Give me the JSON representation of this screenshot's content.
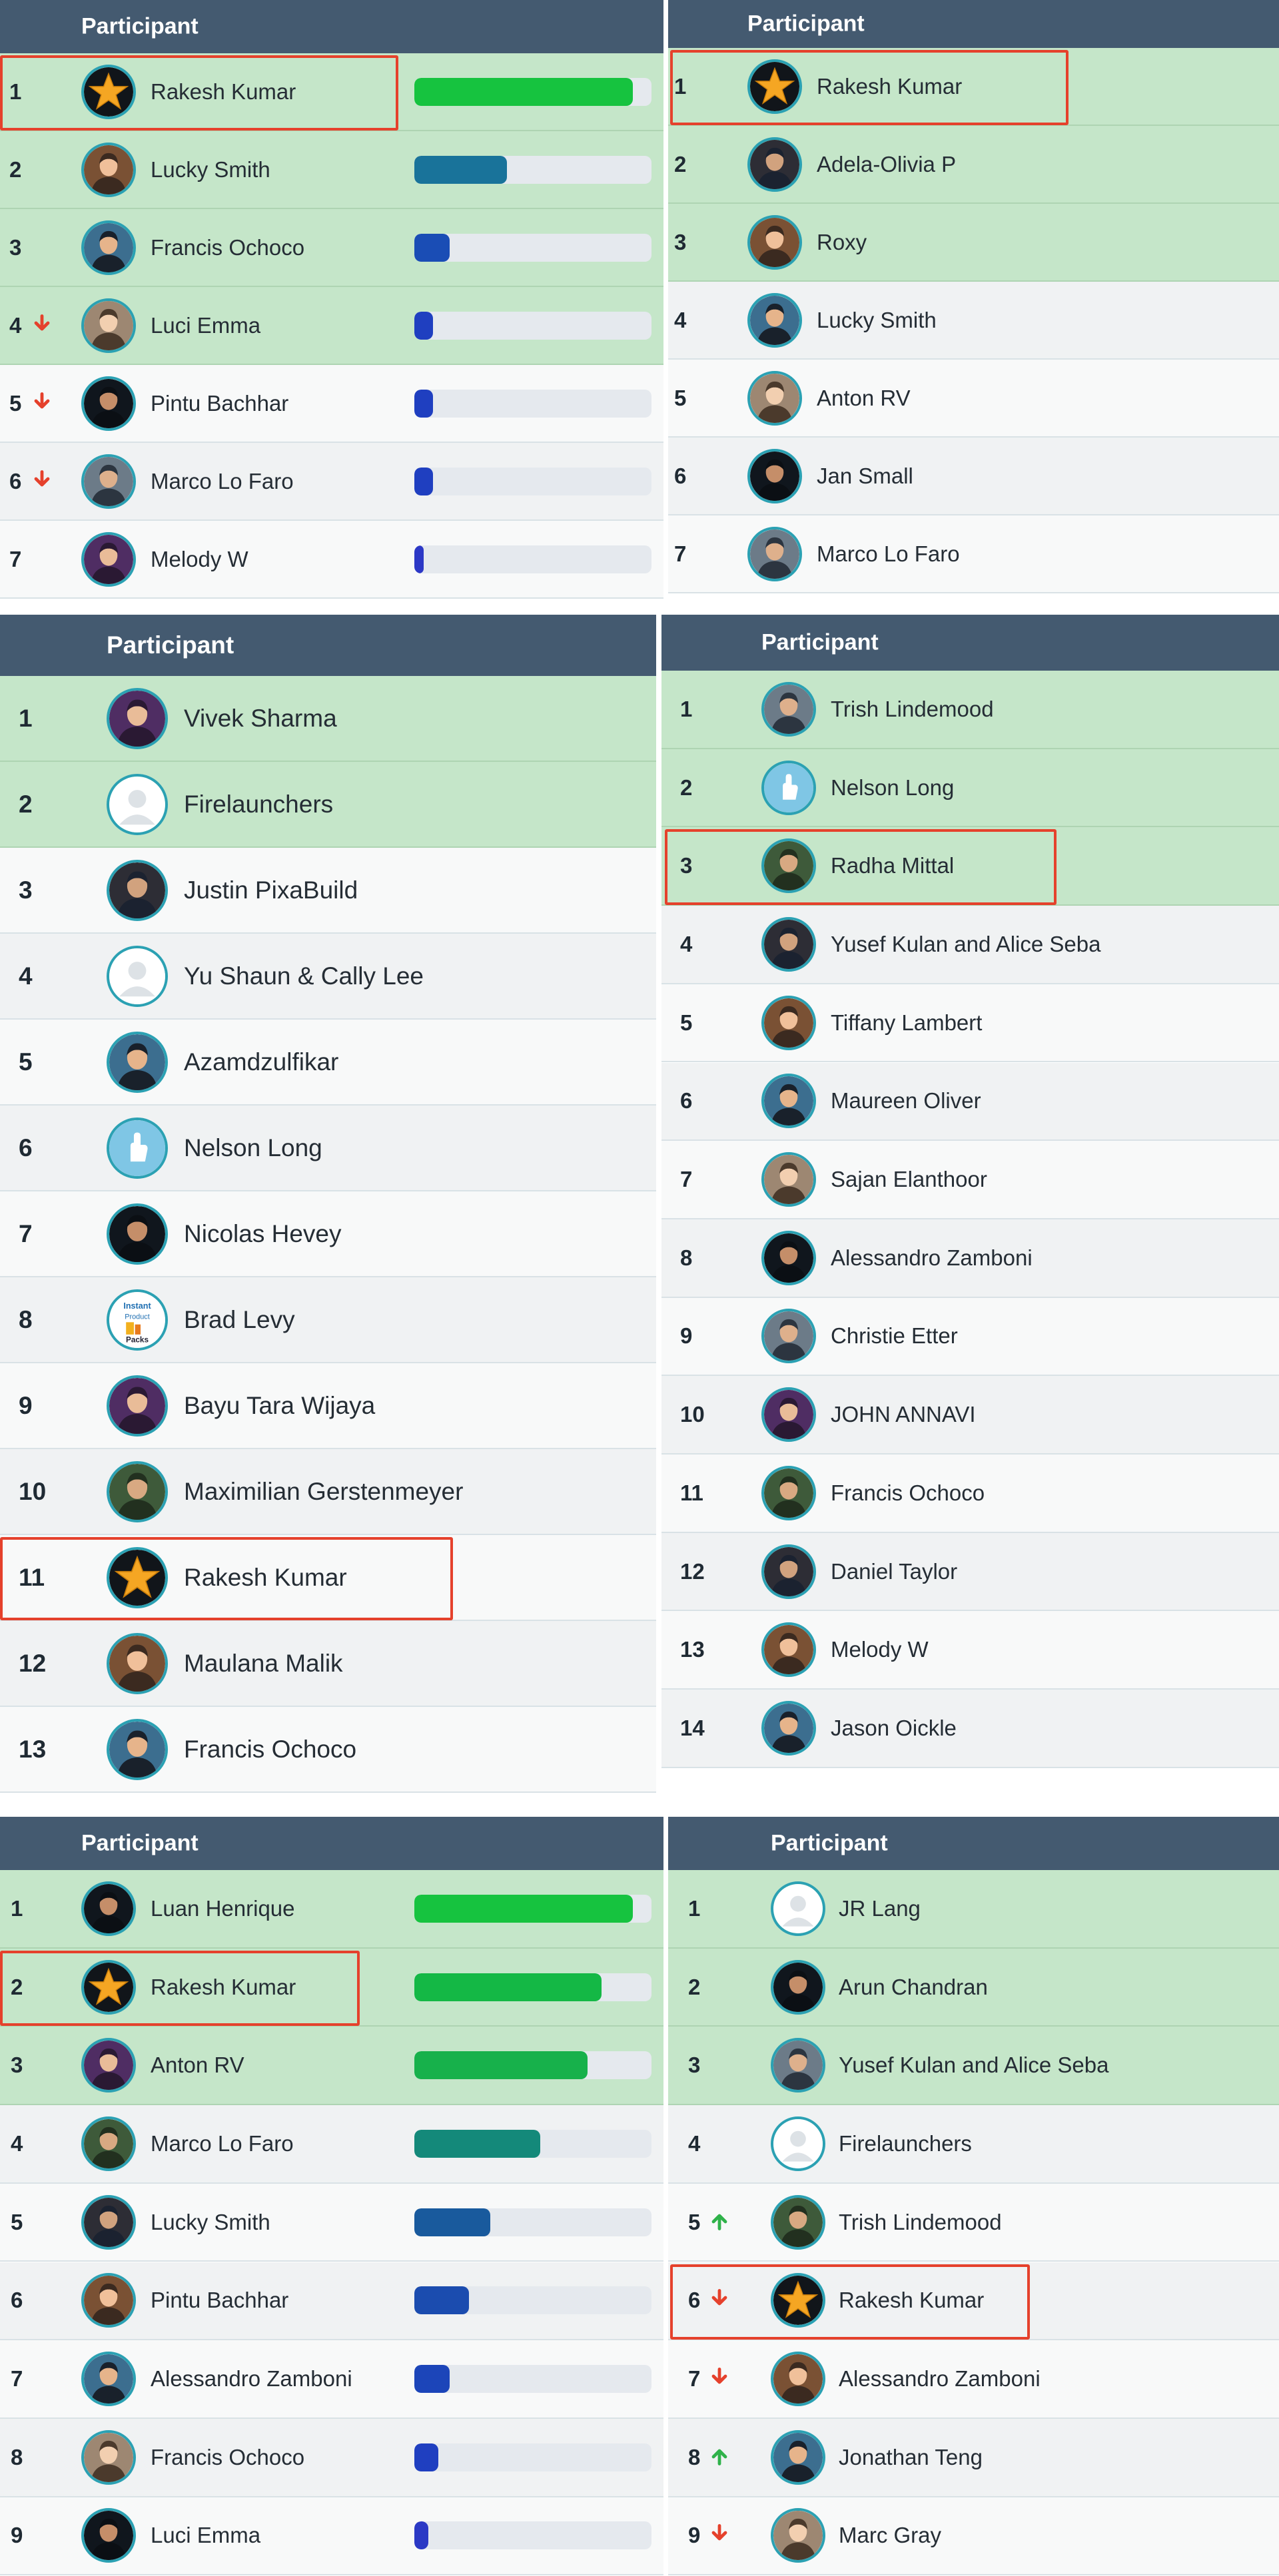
{
  "colors": {
    "header": "#445a70",
    "highlight_row": "#c5e6c9",
    "avatar_ring": "#2ba1b3",
    "callout_border": "#e5412c",
    "arrow_down": "#e5412c",
    "arrow_up": "#2fb24a",
    "bar_track": "#e5e9ee"
  },
  "panels": [
    {
      "id": "panel-1",
      "header": "Participant",
      "has_bars": true,
      "rows": [
        {
          "rank": "1",
          "name": "Rakesh Kumar",
          "avatar": "star-avatar",
          "highlight": true,
          "trend": "",
          "progress": 0.92,
          "bar_color": "#16c33f",
          "callout": true
        },
        {
          "rank": "2",
          "name": "Lucky Smith",
          "avatar": "person-avatar",
          "highlight": true,
          "trend": "",
          "progress": 0.39,
          "bar_color": "#19739a"
        },
        {
          "rank": "3",
          "name": "Francis Ochoco",
          "avatar": "person-avatar",
          "highlight": true,
          "trend": "",
          "progress": 0.15,
          "bar_color": "#1a4db5"
        },
        {
          "rank": "4",
          "name": "Luci Emma",
          "avatar": "person-avatar",
          "highlight": true,
          "trend": "down",
          "progress": 0.08,
          "bar_color": "#1f3fc0"
        },
        {
          "rank": "5",
          "name": "Pintu Bachhar",
          "avatar": "person-avatar",
          "highlight": false,
          "trend": "down",
          "progress": 0.08,
          "bar_color": "#1f3fc0"
        },
        {
          "rank": "6",
          "name": "Marco Lo Faro",
          "avatar": "person-avatar",
          "highlight": false,
          "trend": "down",
          "progress": 0.08,
          "bar_color": "#1f3fc0"
        },
        {
          "rank": "7",
          "name": "Melody W",
          "avatar": "person-avatar",
          "highlight": false,
          "trend": "",
          "progress": 0.04,
          "bar_color": "#2c38c6"
        }
      ]
    },
    {
      "id": "panel-2",
      "header": "Participant",
      "has_bars": false,
      "rows": [
        {
          "rank": "1",
          "name": "Rakesh Kumar",
          "avatar": "star-avatar",
          "highlight": true,
          "trend": "",
          "callout": true
        },
        {
          "rank": "2",
          "name": "Adela-Olivia P",
          "avatar": "person-avatar",
          "highlight": true,
          "trend": ""
        },
        {
          "rank": "3",
          "name": "Roxy",
          "avatar": "person-avatar",
          "highlight": true,
          "trend": ""
        },
        {
          "rank": "4",
          "name": "Lucky Smith",
          "avatar": "person-avatar",
          "highlight": false,
          "trend": ""
        },
        {
          "rank": "5",
          "name": "Anton RV",
          "avatar": "person-avatar",
          "highlight": false,
          "trend": ""
        },
        {
          "rank": "6",
          "name": "Jan Small",
          "avatar": "person-avatar",
          "highlight": false,
          "trend": ""
        },
        {
          "rank": "7",
          "name": "Marco Lo Faro",
          "avatar": "person-avatar",
          "highlight": false,
          "trend": ""
        }
      ]
    },
    {
      "id": "panel-3",
      "header": "Participant",
      "has_bars": false,
      "rows": [
        {
          "rank": "1",
          "name": "Vivek Sharma",
          "avatar": "person-avatar",
          "highlight": true,
          "trend": ""
        },
        {
          "rank": "2",
          "name": "Firelaunchers",
          "avatar": "default-avatar",
          "highlight": true,
          "trend": ""
        },
        {
          "rank": "3",
          "name": "Justin PixaBuild",
          "avatar": "person-avatar",
          "highlight": false,
          "trend": ""
        },
        {
          "rank": "4",
          "name": "Yu Shaun & Cally Lee",
          "avatar": "default-avatar",
          "highlight": false,
          "trend": ""
        },
        {
          "rank": "5",
          "name": "Azamdzulfikar",
          "avatar": "person-avatar",
          "highlight": false,
          "trend": ""
        },
        {
          "rank": "6",
          "name": "Nelson Long",
          "avatar": "hand-avatar",
          "highlight": false,
          "trend": ""
        },
        {
          "rank": "7",
          "name": "Nicolas Hevey",
          "avatar": "person-avatar",
          "highlight": false,
          "trend": ""
        },
        {
          "rank": "8",
          "name": "Brad Levy",
          "avatar": "logo-avatar",
          "avatar_text": [
            "Instant",
            "Product",
            "Packs"
          ],
          "highlight": false,
          "trend": ""
        },
        {
          "rank": "9",
          "name": "Bayu Tara Wijaya",
          "avatar": "person-avatar",
          "highlight": false,
          "trend": ""
        },
        {
          "rank": "10",
          "name": "Maximilian Gerstenmeyer",
          "avatar": "person-avatar",
          "highlight": false,
          "trend": ""
        },
        {
          "rank": "11",
          "name": "Rakesh Kumar",
          "avatar": "star-avatar",
          "highlight": false,
          "trend": "",
          "callout": true
        },
        {
          "rank": "12",
          "name": "Maulana Malik",
          "avatar": "person-avatar",
          "highlight": false,
          "trend": ""
        },
        {
          "rank": "13",
          "name": "Francis Ochoco",
          "avatar": "person-avatar",
          "highlight": false,
          "trend": ""
        }
      ]
    },
    {
      "id": "panel-4",
      "header": "Participant",
      "has_bars": false,
      "rows": [
        {
          "rank": "1",
          "name": "Trish Lindemood",
          "avatar": "person-avatar",
          "highlight": true,
          "trend": ""
        },
        {
          "rank": "2",
          "name": "Nelson Long",
          "avatar": "hand-avatar",
          "highlight": true,
          "trend": ""
        },
        {
          "rank": "3",
          "name": "Radha Mittal",
          "avatar": "person-avatar",
          "highlight": true,
          "trend": "",
          "callout": true
        },
        {
          "rank": "4",
          "name": "Yusef Kulan and Alice Seba",
          "avatar": "person-avatar",
          "highlight": false,
          "trend": ""
        },
        {
          "rank": "5",
          "name": "Tiffany Lambert",
          "avatar": "person-avatar",
          "highlight": false,
          "trend": ""
        },
        {
          "rank": "6",
          "name": "Maureen Oliver",
          "avatar": "person-avatar",
          "highlight": false,
          "trend": ""
        },
        {
          "rank": "7",
          "name": "Sajan Elanthoor",
          "avatar": "person-avatar",
          "highlight": false,
          "trend": ""
        },
        {
          "rank": "8",
          "name": "Alessandro Zamboni",
          "avatar": "person-avatar",
          "highlight": false,
          "trend": ""
        },
        {
          "rank": "9",
          "name": "Christie Etter",
          "avatar": "person-avatar",
          "highlight": false,
          "trend": ""
        },
        {
          "rank": "10",
          "name": "JOHN ANNAVI",
          "avatar": "person-avatar",
          "highlight": false,
          "trend": ""
        },
        {
          "rank": "11",
          "name": "Francis Ochoco",
          "avatar": "person-avatar",
          "highlight": false,
          "trend": ""
        },
        {
          "rank": "12",
          "name": "Daniel Taylor",
          "avatar": "person-avatar",
          "highlight": false,
          "trend": ""
        },
        {
          "rank": "13",
          "name": "Melody W",
          "avatar": "person-avatar",
          "highlight": false,
          "trend": ""
        },
        {
          "rank": "14",
          "name": "Jason Oickle",
          "avatar": "person-avatar",
          "highlight": false,
          "trend": ""
        }
      ]
    },
    {
      "id": "panel-5",
      "header": "Participant",
      "has_bars": true,
      "rows": [
        {
          "rank": "1",
          "name": "Luan Henrique",
          "avatar": "person-avatar",
          "highlight": true,
          "trend": "",
          "progress": 0.92,
          "bar_color": "#16c33f"
        },
        {
          "rank": "2",
          "name": "Rakesh Kumar",
          "avatar": "star-avatar",
          "highlight": true,
          "trend": "",
          "progress": 0.79,
          "bar_color": "#14b845",
          "callout": true
        },
        {
          "rank": "3",
          "name": "Anton RV",
          "avatar": "person-avatar",
          "highlight": true,
          "trend": "",
          "progress": 0.73,
          "bar_color": "#17b14b"
        },
        {
          "rank": "4",
          "name": "Marco Lo Faro",
          "avatar": "person-avatar",
          "highlight": false,
          "trend": "",
          "progress": 0.53,
          "bar_color": "#14897a"
        },
        {
          "rank": "5",
          "name": "Lucky Smith",
          "avatar": "person-avatar",
          "highlight": false,
          "trend": "",
          "progress": 0.32,
          "bar_color": "#195a9d"
        },
        {
          "rank": "6",
          "name": "Pintu Bachhar",
          "avatar": "person-avatar",
          "highlight": false,
          "trend": "",
          "progress": 0.23,
          "bar_color": "#1b4caf"
        },
        {
          "rank": "7",
          "name": "Alessandro Zamboni",
          "avatar": "person-avatar",
          "highlight": false,
          "trend": "",
          "progress": 0.15,
          "bar_color": "#1c45b9"
        },
        {
          "rank": "8",
          "name": "Francis Ochoco",
          "avatar": "person-avatar",
          "highlight": false,
          "trend": "",
          "progress": 0.1,
          "bar_color": "#1f3fc0"
        },
        {
          "rank": "9",
          "name": "Luci Emma",
          "avatar": "person-avatar",
          "highlight": false,
          "trend": "",
          "progress": 0.06,
          "bar_color": "#2b39c5"
        }
      ]
    },
    {
      "id": "panel-6",
      "header": "Participant",
      "has_bars": false,
      "rows": [
        {
          "rank": "1",
          "name": "JR Lang",
          "avatar": "default-avatar",
          "highlight": true,
          "trend": ""
        },
        {
          "rank": "2",
          "name": "Arun Chandran",
          "avatar": "person-avatar",
          "highlight": true,
          "trend": ""
        },
        {
          "rank": "3",
          "name": "Yusef Kulan and Alice Seba",
          "avatar": "person-avatar",
          "highlight": true,
          "trend": ""
        },
        {
          "rank": "4",
          "name": "Firelaunchers",
          "avatar": "default-avatar",
          "highlight": false,
          "trend": ""
        },
        {
          "rank": "5",
          "name": "Trish Lindemood",
          "avatar": "person-avatar",
          "highlight": false,
          "trend": "up"
        },
        {
          "rank": "6",
          "name": "Rakesh Kumar",
          "avatar": "star-avatar",
          "highlight": false,
          "trend": "down",
          "callout": true
        },
        {
          "rank": "7",
          "name": "Alessandro Zamboni",
          "avatar": "person-avatar",
          "highlight": false,
          "trend": "down"
        },
        {
          "rank": "8",
          "name": "Jonathan Teng",
          "avatar": "person-avatar",
          "highlight": false,
          "trend": "up"
        },
        {
          "rank": "9",
          "name": "Marc Gray",
          "avatar": "person-avatar",
          "highlight": false,
          "trend": "down"
        }
      ]
    }
  ]
}
